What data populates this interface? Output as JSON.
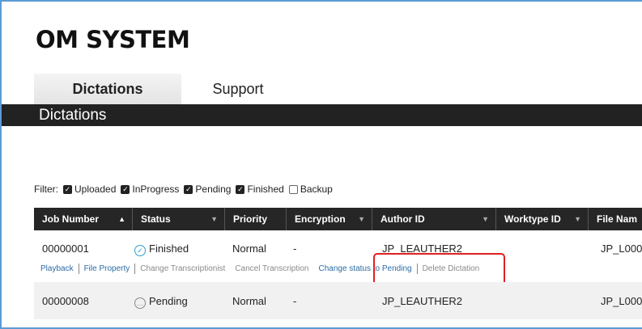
{
  "brand": {
    "logo": "OM SYSTEM"
  },
  "tabs": [
    {
      "label": "Dictations",
      "active": true
    },
    {
      "label": "Support",
      "active": false
    }
  ],
  "page_title": "Dictations",
  "filter": {
    "label": "Filter:",
    "options": [
      {
        "label": "Uploaded",
        "checked": true
      },
      {
        "label": "InProgress",
        "checked": true
      },
      {
        "label": "Pending",
        "checked": true
      },
      {
        "label": "Finished",
        "checked": true
      },
      {
        "label": "Backup",
        "checked": false
      }
    ]
  },
  "table": {
    "columns": [
      "Job Number",
      "Status",
      "Priority",
      "Encryption",
      "Author ID",
      "Worktype ID",
      "File Nam"
    ],
    "rows": [
      {
        "job_number": "00000001",
        "status": "Finished",
        "priority": "Normal",
        "encryption": "-",
        "author_id": "JP_LEAUTHER2",
        "file_name": "JP_L000"
      },
      {
        "job_number": "00000008",
        "status": "Pending",
        "priority": "Normal",
        "encryption": "-",
        "author_id": "JP_LEAUTHER2",
        "file_name": "JP_L000"
      }
    ],
    "row_actions": {
      "playback": "Playback",
      "file_property": "File Property",
      "change_transcriptionist": "Change Transcriptionist",
      "cancel_transcription": "Cancel Transcription",
      "change_status": "Change status to Pending",
      "delete": "Delete Dictation"
    }
  },
  "colors": {
    "accent_link": "#2a6ca5",
    "highlight": "#e02020",
    "header_bg": "#262626"
  },
  "icons": {
    "finished": "check-circle-icon",
    "pending": "ellipsis-circle-icon",
    "sort_asc": "sort-up-icon",
    "sort_menu": "dropdown-caret-icon"
  }
}
